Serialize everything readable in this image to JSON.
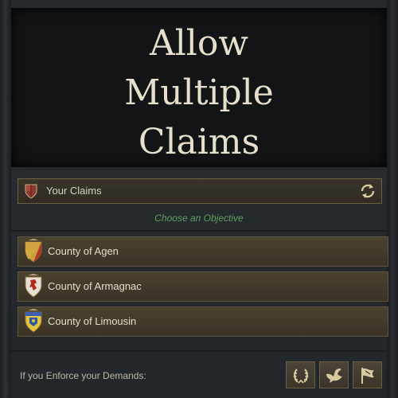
{
  "title": "Allow\nMultiple\nClaims",
  "claims_bar": {
    "label": "Your Claims",
    "icon": "shield-icon",
    "action_icon": "refresh-icon"
  },
  "objective_heading": "Choose an Objective",
  "counties": [
    {
      "name": "County of Agen",
      "icon": "coat-of-arms-agen"
    },
    {
      "name": "County of Armagnac",
      "icon": "coat-of-arms-armagnac"
    },
    {
      "name": "County of Limousin",
      "icon": "coat-of-arms-limousin"
    }
  ],
  "enforce": {
    "label": "If you Enforce your Demands:",
    "buttons": [
      {
        "icon": "laurel-wreath-icon"
      },
      {
        "icon": "dove-icon"
      },
      {
        "icon": "flag-icon"
      }
    ]
  },
  "colors": {
    "accent_green": "#5ea25c",
    "title_text": "#e6dfcc",
    "row_gold": "#4a4130"
  }
}
